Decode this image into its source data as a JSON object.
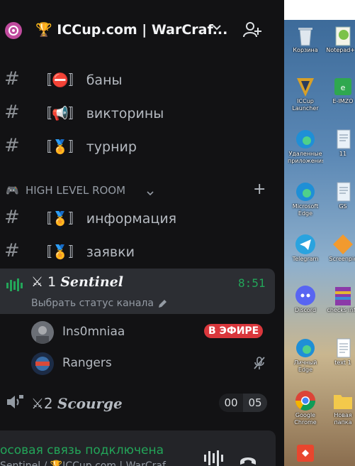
{
  "server": {
    "name": "🏆 ICCup.com | WarCraf..."
  },
  "channels": [
    {
      "brackets": "〚⛔〛",
      "label": "баны"
    },
    {
      "brackets": "〚📢〛",
      "label": "викторины"
    },
    {
      "brackets": "〚🏅〛",
      "label": "турнир"
    },
    {
      "brackets": "〚🏅〛",
      "label": "информация"
    },
    {
      "brackets": "〚🏅〛",
      "label": "заявки"
    }
  ],
  "category": {
    "icon": "🎮",
    "name": "HIGH LEVEL ROOM"
  },
  "voice_active": {
    "prefix": "⚔ 1 ",
    "name": "Sentinel",
    "time": "8:51",
    "status": "Выбрать статус канала"
  },
  "members": [
    {
      "name": "Ins0mniaa",
      "badge": "В ЭФИРЕ"
    },
    {
      "name": "Rangers"
    }
  ],
  "voice_scourge": {
    "prefix": "⚔2 ",
    "name": "Scourge",
    "count_a": "00",
    "count_b": "05"
  },
  "voice_panel": {
    "connected": "осовая связь подключена",
    "sub": "Sentinel / 🏆ICCup.com | WarCraf"
  },
  "desktop": {
    "icons": [
      {
        "label": "Корзина",
        "icon": "recycle-bin-icon"
      },
      {
        "label": "Notepad++",
        "icon": "notepad-plus-icon"
      },
      {
        "label": "ICCup Launcher",
        "icon": "iccup-launcher-icon"
      },
      {
        "label": "E-IMZO",
        "icon": "e-imzo-icon"
      },
      {
        "label": "Удаленные приложения",
        "icon": "edge-remote-icon"
      },
      {
        "label": "11",
        "icon": "document-icon"
      },
      {
        "label": "Microsoft Edge",
        "icon": "edge-icon"
      },
      {
        "label": "GS",
        "icon": "document-icon"
      },
      {
        "label": "Telegram",
        "icon": "telegram-icon"
      },
      {
        "label": "Screenpic",
        "icon": "screenpic-icon"
      },
      {
        "label": "Discord",
        "icon": "discord-icon"
      },
      {
        "label": "checks info",
        "icon": "archive-icon"
      },
      {
        "label": "Личный Edge",
        "icon": "edge-icon"
      },
      {
        "label": "text 1",
        "icon": "text-file-icon"
      },
      {
        "label": "Google Chrome",
        "icon": "chrome-icon"
      },
      {
        "label": "Новая папка",
        "icon": "folder-icon"
      }
    ]
  },
  "colors": {
    "accent_green": "#23a559",
    "live_red": "#da373c",
    "sidebar_bg": "#121214"
  }
}
